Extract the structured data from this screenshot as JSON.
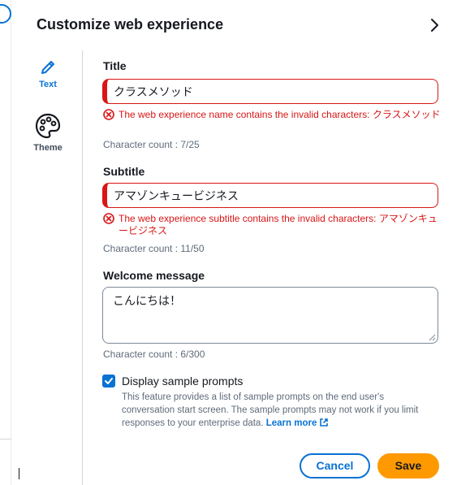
{
  "panel": {
    "title": "Customize web experience"
  },
  "rail": {
    "items": [
      {
        "label": "Text",
        "icon": "pencil-icon",
        "active": true
      },
      {
        "label": "Theme",
        "icon": "palette-icon",
        "active": false
      }
    ]
  },
  "form": {
    "title": {
      "label": "Title",
      "value": "クラスメソッド",
      "error": "The web experience name contains the invalid characters: クラスメソッド",
      "count": "Character count : 7/25"
    },
    "subtitle": {
      "label": "Subtitle",
      "value": "アマゾンキュービジネス",
      "error": "The web experience subtitle contains the invalid characters: アマゾンキュービジネス",
      "count": "Character count : 11/50"
    },
    "welcome": {
      "label": "Welcome message",
      "value": "こんにちは！",
      "count": "Character count : 6/300"
    },
    "sample_prompts": {
      "label": "Display sample prompts",
      "checked": true,
      "help": "This feature provides a list of sample prompts on the end user's conversation start screen. The sample prompts may not work if you limit responses to your enterprise data.",
      "learn_more": "Learn more"
    }
  },
  "actions": {
    "cancel": "Cancel",
    "save": "Save"
  },
  "colors": {
    "accent": "#0972d3",
    "error": "#d91515",
    "primary_button": "#ff9900"
  }
}
